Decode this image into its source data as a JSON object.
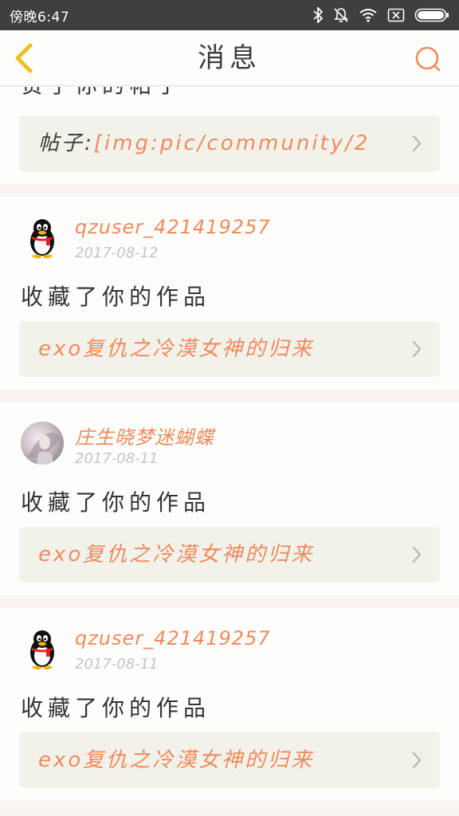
{
  "status_bar": {
    "time": "傍晚6:47",
    "icons": [
      "bluetooth-icon",
      "mute-icon",
      "wifi-icon",
      "sim-icon",
      "battery-icon"
    ]
  },
  "header": {
    "title": "消息",
    "back_icon": "chevron-left-icon",
    "search_icon": "search-icon"
  },
  "colors": {
    "accent": "#f08a5d",
    "back": "#f0c020",
    "link_box": "#f2f2ea",
    "page_bg": "#f7f4f2",
    "status_bar": "#3f3f3f"
  },
  "notifications": [
    {
      "partial": true,
      "action": "赞了你的帖子",
      "link_label": "帖子:",
      "link_text": "[img:pic/community/2"
    },
    {
      "avatar": "qq-penguin-avatar",
      "username": "qzuser_421419257",
      "date": "2017-08-12",
      "action": "收藏了你的作品",
      "link_text": "exo复仇之冷漠女神的归来"
    },
    {
      "avatar": "photo-avatar",
      "username": "庄生晓梦迷蝴蝶",
      "date": "2017-08-11",
      "action": "收藏了你的作品",
      "link_text": "exo复仇之冷漠女神的归来"
    },
    {
      "avatar": "qq-penguin-avatar",
      "username": "qzuser_421419257",
      "date": "2017-08-11",
      "action": "收藏了你的作品",
      "link_text": "exo复仇之冷漠女神的归来"
    }
  ]
}
